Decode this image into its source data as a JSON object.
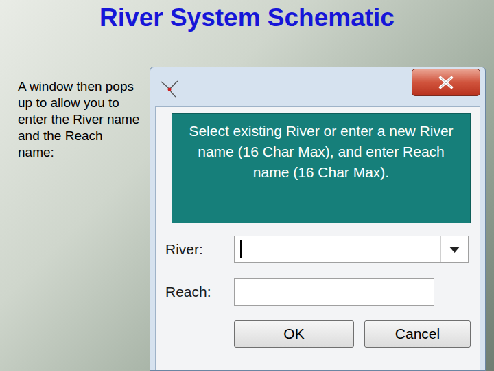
{
  "slide": {
    "title": "River System Schematic",
    "body": "A window then pops up to allow you to enter the River name and the Reach name:"
  },
  "dialog": {
    "message": "Select existing River or enter a new River name (16 Char Max), and enter Reach name (16 Char Max).",
    "fields": [
      {
        "label": "River:",
        "kind": "dropdown",
        "value": "",
        "focused": true
      },
      {
        "label": "Reach:",
        "kind": "text",
        "value": "",
        "focused": false
      }
    ],
    "buttons": [
      "OK",
      "Cancel"
    ]
  }
}
